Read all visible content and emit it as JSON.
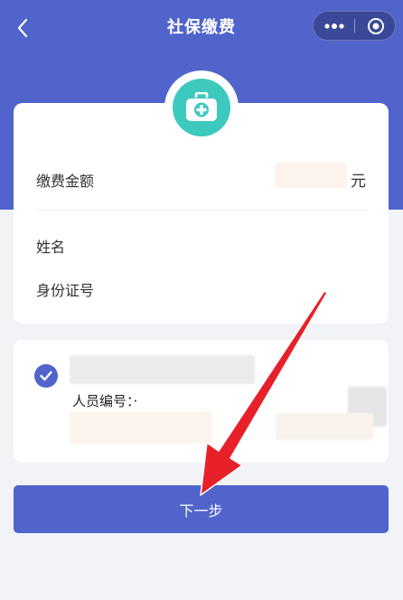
{
  "nav": {
    "title": "社保缴费",
    "back_icon": "chevron-left-icon",
    "more_icon": "more-dots-icon",
    "close_icon": "circle-target-icon"
  },
  "payment": {
    "amount_label": "缴费金额",
    "amount_unit": "元",
    "name_label": "姓名",
    "id_label": "身份证号",
    "badge_icon": "medical-kit-icon"
  },
  "person": {
    "number_label": "人员编号：·",
    "selected": true
  },
  "actions": {
    "next_label": "下一步"
  },
  "colors": {
    "brand": "#5064cc",
    "badge": "#3ec9bf",
    "annotation_arrow": "#e8202a"
  }
}
